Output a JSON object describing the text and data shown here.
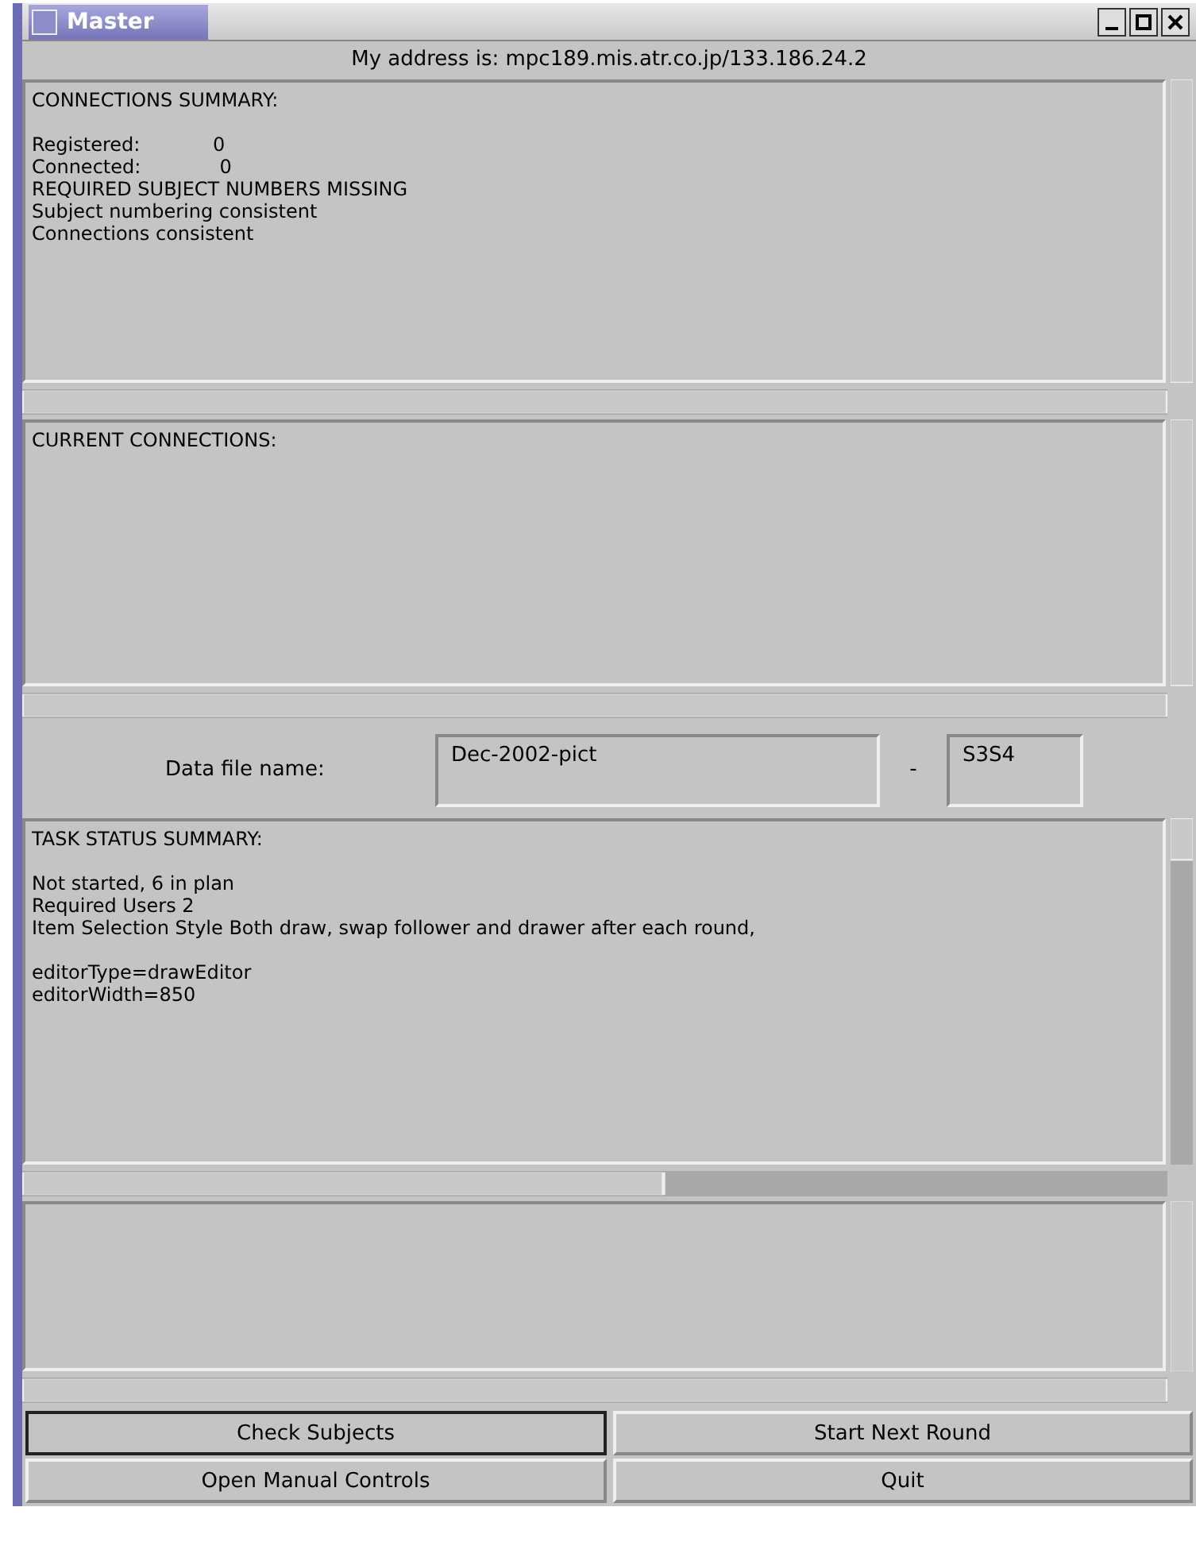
{
  "window": {
    "title": "Master"
  },
  "address": "My address is: mpc189.mis.atr.co.jp/133.186.24.2",
  "panels": [
    {
      "paragraphs": [
        [
          "CONNECTIONS SUMMARY:"
        ],
        [
          "Registered:            0",
          "Connected:             0",
          "REQUIRED SUBJECT NUMBERS MISSING",
          "Subject numbering consistent",
          "Connections consistent"
        ]
      ]
    },
    {
      "paragraphs": [
        [
          "CURRENT CONNECTIONS:"
        ]
      ]
    },
    {
      "paragraphs": [
        [
          "TASK STATUS SUMMARY:"
        ],
        [
          "Not started, 6 in plan",
          "Required Users 2",
          "Item Selection Style Both draw, swap follower and drawer after each round,"
        ],
        [
          "editorType=drawEditor",
          "editorWidth=850"
        ]
      ]
    }
  ],
  "data_file": {
    "label": "Data file name:",
    "name": "Dec-2002-pict",
    "separator": "-",
    "suffix": "S3S4"
  },
  "buttons": [
    {
      "label": "Check Subjects",
      "focused": true
    },
    {
      "label": "Start Next Round",
      "focused": false
    },
    {
      "label": "Open Manual Controls",
      "focused": false
    },
    {
      "label": "Quit",
      "focused": false
    }
  ]
}
